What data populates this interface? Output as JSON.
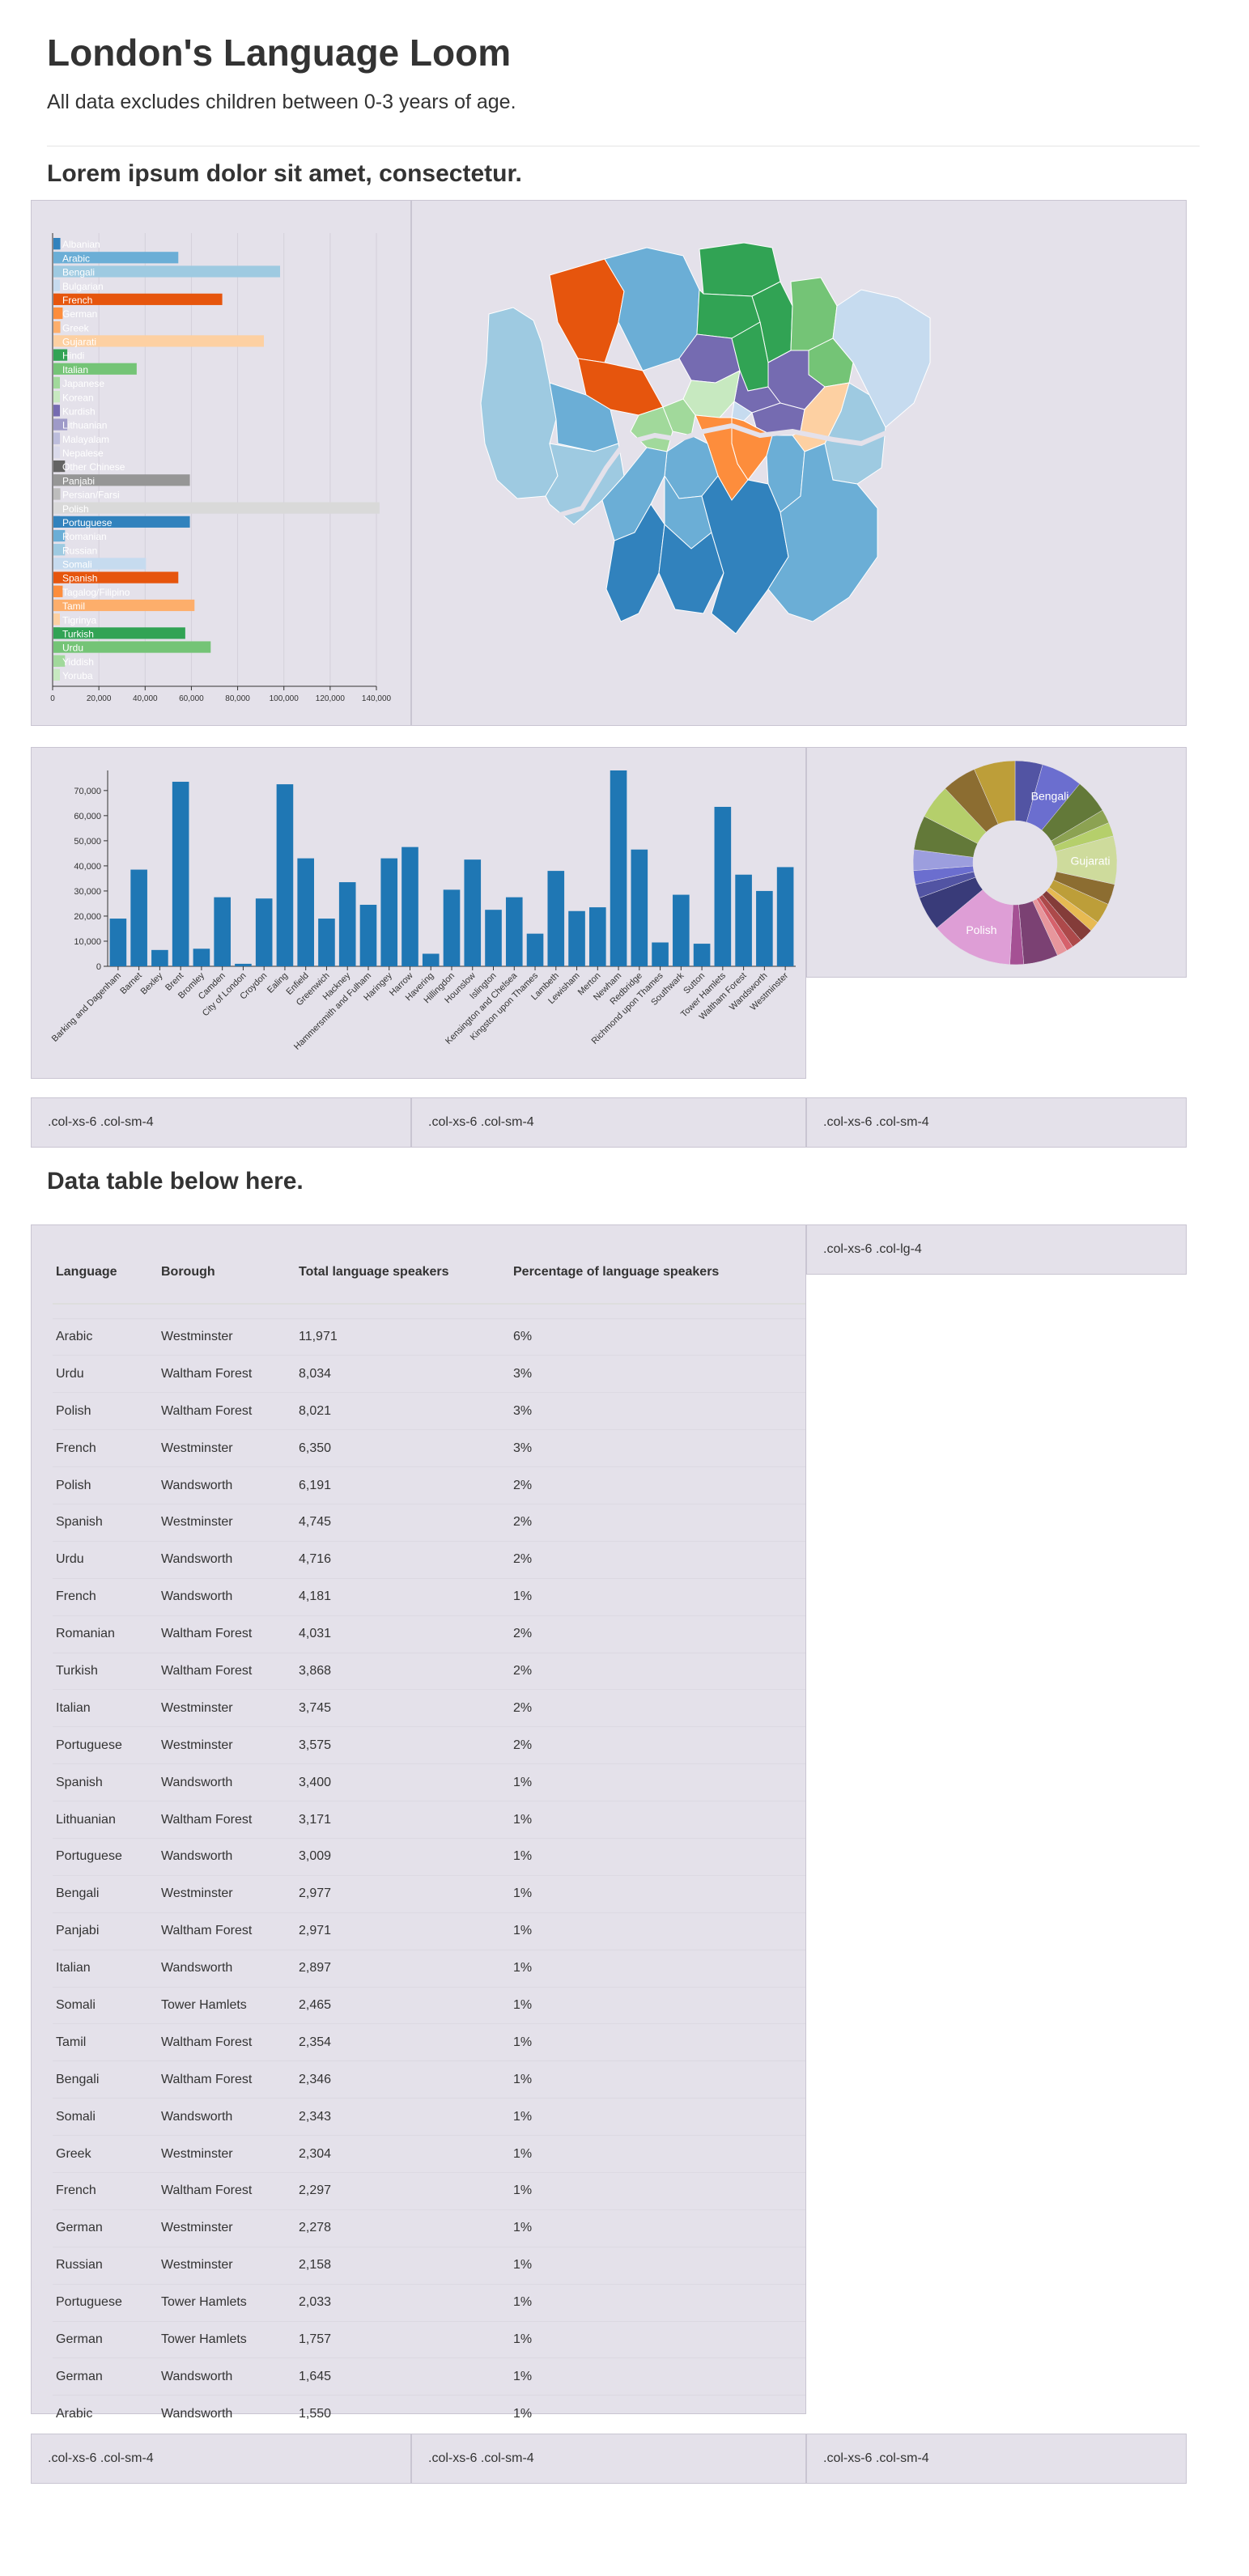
{
  "page": {
    "title": "London's Language Loom",
    "subtitle": "All data excludes children between 0-3 years of age.",
    "section_heading": "Lorem ipsum dolor sit amet, consectetur.",
    "table_heading": "Data table below here."
  },
  "grid_labels": {
    "row1": [
      ".col-xs-6 .col-sm-4",
      ".col-xs-6 .col-sm-4",
      ".col-xs-6 .col-sm-4"
    ],
    "side": ".col-xs-6 .col-lg-4",
    "row2": [
      ".col-xs-6 .col-sm-4",
      ".col-xs-6 .col-sm-4",
      ".col-xs-6 .col-sm-4"
    ]
  },
  "colors": {
    "panel_bg": "#e4e1ea",
    "bar_blue": "#1f77b4"
  },
  "chart_data": [
    {
      "type": "bar",
      "orientation": "horizontal",
      "categories": [
        "Albanian",
        "Arabic",
        "Bengali",
        "Bulgarian",
        "French",
        "German",
        "Greek",
        "Gujarati",
        "Hindi",
        "Italian",
        "Japanese",
        "Korean",
        "Kurdish",
        "Lithuanian",
        "Malayalam",
        "Nepalese",
        "Other Chinese",
        "Panjabi",
        "Persian/Farsi",
        "Polish",
        "Portuguese",
        "Romanian",
        "Russian",
        "Somali",
        "Spanish",
        "Tagalog/Filipino",
        "Tamil",
        "Tigrinya",
        "Turkish",
        "Urdu",
        "Yiddish",
        "Yoruba"
      ],
      "values": [
        3000,
        54000,
        98000,
        2000,
        73000,
        4000,
        3000,
        91000,
        6000,
        36000,
        2000,
        1500,
        2000,
        6000,
        2000,
        2000,
        5000,
        59000,
        3000,
        141000,
        59000,
        5000,
        5000,
        40000,
        54000,
        4000,
        61000,
        2000,
        57000,
        68000,
        5000,
        2000
      ],
      "colors": [
        "#3182bd",
        "#6baed6",
        "#9ecae1",
        "#c6dbef",
        "#e6550d",
        "#fd8d3c",
        "#fdae6b",
        "#fdd0a2",
        "#31a354",
        "#74c476",
        "#a1d99b",
        "#c7e9c0",
        "#756bb1",
        "#9e9ac8",
        "#bcbddc",
        "#dadaeb",
        "#636363",
        "#969696",
        "#bdbdbd",
        "#d9d9d9",
        "#3182bd",
        "#6baed6",
        "#9ecae1",
        "#c6dbef",
        "#e6550d",
        "#fd8d3c",
        "#fdae6b",
        "#fdd0a2",
        "#31a354",
        "#74c476",
        "#a1d99b",
        "#c7e9c0"
      ],
      "xticks": [
        "0",
        "20,000",
        "40,000",
        "60,000",
        "80,000",
        "100,000",
        "120,000",
        "140,000"
      ],
      "xlim": [
        0,
        140000
      ],
      "grid": true
    },
    {
      "type": "bar",
      "categories": [
        "Barking and Dagenham",
        "Barnet",
        "Bexley",
        "Brent",
        "Bromley",
        "Camden",
        "City of London",
        "Croydon",
        "Ealing",
        "Enfield",
        "Greenwich",
        "Hackney",
        "Hammersmith and Fulham",
        "Haringey",
        "Harrow",
        "Havering",
        "Hillingdon",
        "Hounslow",
        "Islington",
        "Kensington and Chelsea",
        "Kingston upon Thames",
        "Lambeth",
        "Lewisham",
        "Merton",
        "Newham",
        "Redbridge",
        "Richmond upon Thames",
        "Southwark",
        "Sutton",
        "Tower Hamlets",
        "Waltham Forest",
        "Wandsworth",
        "Westminster"
      ],
      "values": [
        19000,
        38500,
        6500,
        73500,
        7000,
        27500,
        1000,
        27000,
        72500,
        43000,
        19000,
        33500,
        24500,
        43000,
        47500,
        5000,
        30500,
        42500,
        22500,
        27500,
        13000,
        38000,
        22000,
        23500,
        78000,
        46500,
        9500,
        28500,
        9000,
        63500,
        36500,
        30000,
        39500
      ],
      "yticks": [
        "0",
        "10,000",
        "20,000",
        "30,000",
        "40,000",
        "50,000",
        "60,000",
        "70,000"
      ],
      "ylim": [
        0,
        78000
      ]
    },
    {
      "type": "pie",
      "donut": true,
      "labels": [
        "Bengali",
        "Gujarati",
        "Polish"
      ],
      "slices": [
        {
          "value": 4,
          "color": "#5254a3"
        },
        {
          "value": 6,
          "color": "#6b6ecf",
          "label": "Bengali"
        },
        {
          "value": 5,
          "color": "#637939"
        },
        {
          "value": 2,
          "color": "#8ca252"
        },
        {
          "value": 2,
          "color": "#b5cf6b"
        },
        {
          "value": 7,
          "color": "#cedb9c",
          "label": "Gujarati"
        },
        {
          "value": 3,
          "color": "#8c6d31"
        },
        {
          "value": 3,
          "color": "#bd9e39"
        },
        {
          "value": 1.5,
          "color": "#e7ba52"
        },
        {
          "value": 2,
          "color": "#843c39"
        },
        {
          "value": 1.5,
          "color": "#ad494a"
        },
        {
          "value": 1,
          "color": "#d6616b"
        },
        {
          "value": 1.5,
          "color": "#e7969c"
        },
        {
          "value": 5,
          "color": "#7b4173"
        },
        {
          "value": 2,
          "color": "#a55194"
        },
        {
          "value": 12,
          "color": "#de9ed6",
          "label": "Polish"
        },
        {
          "value": 5,
          "color": "#393b79"
        },
        {
          "value": 2,
          "color": "#5254a3"
        },
        {
          "value": 2,
          "color": "#6b6ecf"
        },
        {
          "value": 3,
          "color": "#9c9ede"
        },
        {
          "value": 5,
          "color": "#637939"
        },
        {
          "value": 5,
          "color": "#b5cf6b"
        },
        {
          "value": 5,
          "color": "#8c6d31"
        },
        {
          "value": 6,
          "color": "#bd9e39"
        }
      ]
    },
    {
      "type": "table",
      "columns": [
        "Language",
        "Borough",
        "Total language speakers",
        "Percentage of language speakers"
      ],
      "rows": [
        [
          "Arabic",
          "Westminster",
          "11,971",
          "6%"
        ],
        [
          "Urdu",
          "Waltham Forest",
          "8,034",
          "3%"
        ],
        [
          "Polish",
          "Waltham Forest",
          "8,021",
          "3%"
        ],
        [
          "French",
          "Westminster",
          "6,350",
          "3%"
        ],
        [
          "Polish",
          "Wandsworth",
          "6,191",
          "2%"
        ],
        [
          "Spanish",
          "Westminster",
          "4,745",
          "2%"
        ],
        [
          "Urdu",
          "Wandsworth",
          "4,716",
          "2%"
        ],
        [
          "French",
          "Wandsworth",
          "4,181",
          "1%"
        ],
        [
          "Romanian",
          "Waltham Forest",
          "4,031",
          "2%"
        ],
        [
          "Turkish",
          "Waltham Forest",
          "3,868",
          "2%"
        ],
        [
          "Italian",
          "Westminster",
          "3,745",
          "2%"
        ],
        [
          "Portuguese",
          "Westminster",
          "3,575",
          "2%"
        ],
        [
          "Spanish",
          "Wandsworth",
          "3,400",
          "1%"
        ],
        [
          "Lithuanian",
          "Waltham Forest",
          "3,171",
          "1%"
        ],
        [
          "Portuguese",
          "Wandsworth",
          "3,009",
          "1%"
        ],
        [
          "Bengali",
          "Westminster",
          "2,977",
          "1%"
        ],
        [
          "Panjabi",
          "Waltham Forest",
          "2,971",
          "1%"
        ],
        [
          "Italian",
          "Wandsworth",
          "2,897",
          "1%"
        ],
        [
          "Somali",
          "Tower Hamlets",
          "2,465",
          "1%"
        ],
        [
          "Tamil",
          "Waltham Forest",
          "2,354",
          "1%"
        ],
        [
          "Bengali",
          "Waltham Forest",
          "2,346",
          "1%"
        ],
        [
          "Somali",
          "Wandsworth",
          "2,343",
          "1%"
        ],
        [
          "Greek",
          "Westminster",
          "2,304",
          "1%"
        ],
        [
          "French",
          "Waltham Forest",
          "2,297",
          "1%"
        ],
        [
          "German",
          "Westminster",
          "2,278",
          "1%"
        ],
        [
          "Russian",
          "Westminster",
          "2,158",
          "1%"
        ],
        [
          "Portuguese",
          "Tower Hamlets",
          "2,033",
          "1%"
        ],
        [
          "German",
          "Tower Hamlets",
          "1,757",
          "1%"
        ],
        [
          "German",
          "Wandsworth",
          "1,645",
          "1%"
        ],
        [
          "Arabic",
          "Wandsworth",
          "1,550",
          "1%"
        ]
      ]
    }
  ]
}
